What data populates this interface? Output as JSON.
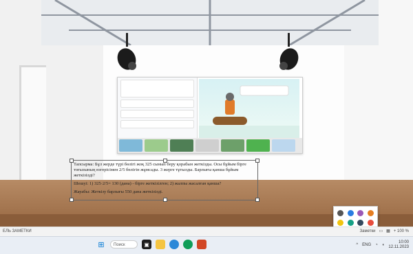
{
  "slide_text": {
    "paragraph1": "Тапсырма: Бұл жерде түрі бөлігі жоқ 325 сынып беру қорабын жеткізды. Осы бұйым бірге тоғызының өзгерісімен 2/5 бөлігін жұмсады. 3 жерге тұтылды. Барлығы қанша бұйым жеткізілді?",
    "paragraph2": "Шешуі: 1) 325·2/5= 130 (дана) - бірге жеткізілген; 2) жалпы жасалған қанша?",
    "paragraph3": "Жауабы: Жеткізу барлығы 550 дана жеткізілді."
  },
  "statusbar": {
    "left": "ЕЛЬ ЗАМЕТКИ",
    "notes": "Заметки",
    "zoom": "+ 100 %"
  },
  "taskbar": {
    "search_label": "Поиск",
    "lang": "ENG",
    "time": "10:00",
    "date": "12.11.2023"
  },
  "colors": {
    "floor": "#a97a52",
    "taskbar": "#e9eef5",
    "accent": "#0078d4"
  }
}
